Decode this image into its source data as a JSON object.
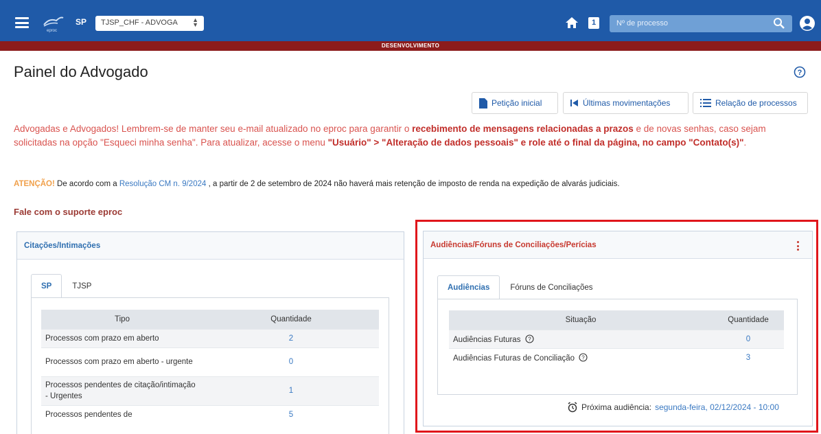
{
  "navbar": {
    "sp_label": "SP",
    "profile_select": "TJSP_CHF - ADVOGA",
    "badge_count": "1",
    "search_placeholder": "Nº de processo",
    "env_label": "DESENVOLVIMENTO"
  },
  "page": {
    "title": "Painel do Advogado"
  },
  "actions": {
    "peticao": "Petição inicial",
    "ultimas": "Últimas movimentações",
    "relacao": "Relação de processos"
  },
  "notice": {
    "p1": "Advogadas e Advogados! Lembrem-se de manter seu e-mail atualizado no eproc para garantir o ",
    "b1": "recebimento de mensagens relacionadas a prazos",
    "p2": " e de novas senhas, caso sejam solicitadas na opção \"Esqueci minha senha\". Para atualizar, acesse o menu ",
    "b2": "\"Usuário\" > \"Alteração de dados pessoais\" e role até o final da página, no campo \"Contato(s)\"",
    "p3": "."
  },
  "atencao": {
    "label": "ATENÇÃO!",
    "text1": " De acordo com a ",
    "link": "Resolução CM n. 9/2024",
    "text2": " , a partir de 2 de setembro de 2024 não haverá mais retenção de imposto de renda na expedição de alvarás judiciais."
  },
  "support_link": "Fale com o suporte eproc",
  "citacoes": {
    "title": "Citações/Intimações",
    "tabs": [
      "SP",
      "TJSP"
    ],
    "headers": [
      "Tipo",
      "Quantidade"
    ],
    "rows": [
      {
        "tipo": "Processos com prazo em aberto",
        "qtd": "2"
      },
      {
        "tipo": "Processos com prazo em aberto - urgente",
        "qtd": "0"
      },
      {
        "tipo": "Processos pendentes de citação/intimação - Urgentes",
        "qtd": "1"
      },
      {
        "tipo": "Processos pendentes de",
        "qtd": "5"
      }
    ]
  },
  "audiencias": {
    "title": "Audiências/Fóruns de Conciliações/Perícias",
    "tabs": [
      "Audiências",
      "Fóruns de Conciliações"
    ],
    "headers": [
      "Situação",
      "Quantidade"
    ],
    "rows": [
      {
        "situacao": "Audiências Futuras",
        "qtd": "0"
      },
      {
        "situacao": "Audiências Futuras de Conciliação",
        "qtd": "3"
      }
    ],
    "next_label": "Próxima audiência:",
    "next_value": "segunda-feira, 02/12/2024 - 10:00"
  },
  "colors": {
    "navbar": "#1f5aa8",
    "env_bar": "#8c1c1c",
    "highlight_frame": "#e0161b",
    "link": "#3a79c2"
  }
}
